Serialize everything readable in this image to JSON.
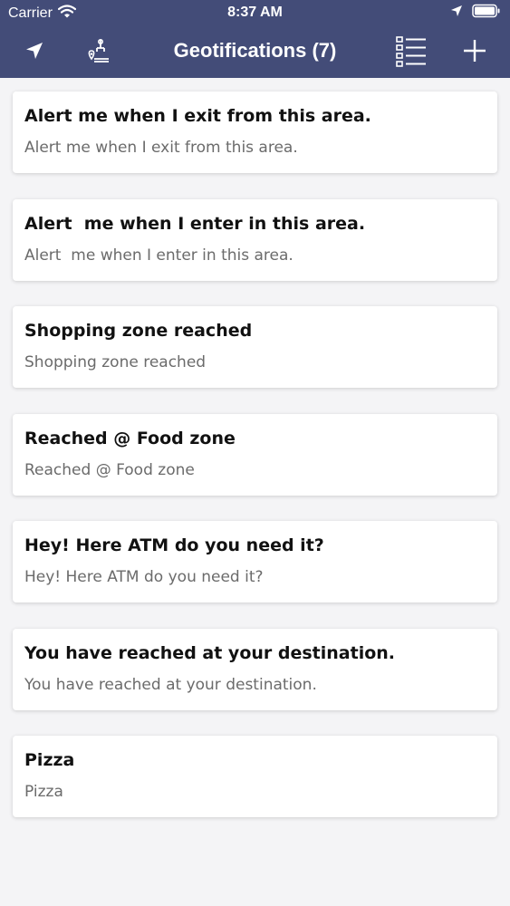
{
  "status_bar": {
    "carrier": "Carrier",
    "time": "8:37 AM",
    "icons": [
      "wifi-icon",
      "location-arrow-icon",
      "battery-icon"
    ]
  },
  "nav_bar": {
    "title": "Geotifications (7)",
    "icons": [
      "location-arrow-icon",
      "map-pin-icon",
      "list-icon",
      "plus-icon"
    ],
    "background": "#434c78"
  },
  "geotifications": [
    {
      "title": "Alert me when I exit from this area.",
      "subtitle": "Alert me when I exit from this area."
    },
    {
      "title": "Alert  me when I enter in this area.",
      "subtitle": "Alert  me when I enter in this area."
    },
    {
      "title": "Shopping zone reached",
      "subtitle": "Shopping zone reached"
    },
    {
      "title": "Reached @ Food zone",
      "subtitle": "Reached @ Food zone"
    },
    {
      "title": "Hey! Here ATM do you need it?",
      "subtitle": "Hey! Here ATM do you need it?"
    },
    {
      "title": "You have reached at your destination.",
      "subtitle": "You have reached at your destination."
    },
    {
      "title": "Pizza",
      "subtitle": "Pizza"
    }
  ]
}
